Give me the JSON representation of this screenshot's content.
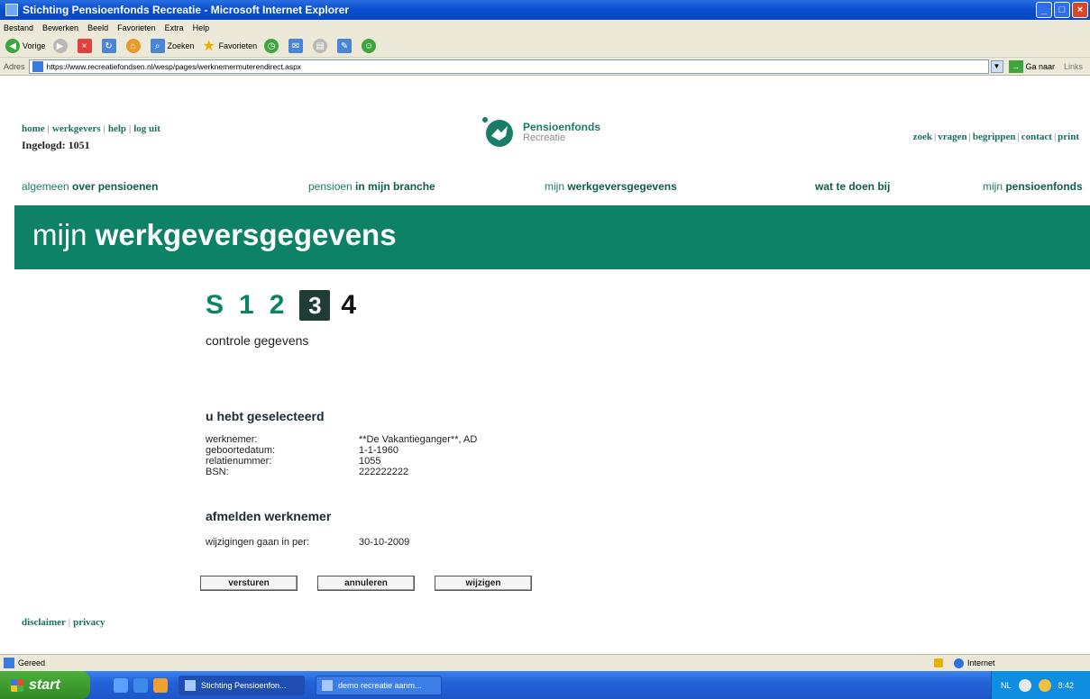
{
  "window": {
    "title": "Stichting Pensioenfonds Recreatie - Microsoft Internet Explorer"
  },
  "menu": [
    "Bestand",
    "Bewerken",
    "Beeld",
    "Favorieten",
    "Extra",
    "Help"
  ],
  "toolbar": {
    "back_label": "Vorige",
    "search_label": "Zoeken",
    "favorites_label": "Favorieten"
  },
  "address": {
    "label": "Adres",
    "url": "https://www.recreatiefondsen.nl/wesp/pages/werknemermuterendirect.aspx",
    "go_label": "Ga naar",
    "links_label": "Links"
  },
  "site": {
    "top_links": [
      "home",
      "werkgevers",
      "help",
      "log uit"
    ],
    "logged_in": "Ingelogd: 1051",
    "logo_title": "Pensioenfonds",
    "logo_subtitle": "Recreatie",
    "util_links": [
      "zoek",
      "vragen",
      "begrippen",
      "contact",
      "print"
    ],
    "nav": [
      {
        "pre": "algemeen ",
        "bold": "over pensioenen"
      },
      {
        "pre": "pensioen ",
        "bold": "in mijn branche"
      },
      {
        "pre": "mijn ",
        "bold": "werkgeversgegevens"
      },
      {
        "pre": "",
        "bold": "wat te doen bij"
      },
      {
        "pre": "mijn ",
        "bold": "pensioenfonds"
      }
    ],
    "banner_pre": "mijn ",
    "banner_bold": "werkgeversgegevens"
  },
  "steps": {
    "items": [
      "S",
      "1",
      "2",
      "3",
      "4"
    ],
    "active": "3",
    "caption": "controle gegevens"
  },
  "selection": {
    "heading": "u hebt geselecteerd",
    "rows": [
      {
        "label": "werknemer:",
        "value": "**De Vakantieganger**, AD"
      },
      {
        "label": "geboortedatum:",
        "value": "1-1-1960"
      },
      {
        "label": "relatienummer:",
        "value": "1055"
      },
      {
        "label": "BSN:",
        "value": "222222222"
      }
    ]
  },
  "deregister": {
    "heading": "afmelden werknemer",
    "rows": [
      {
        "label": "wijzigingen gaan in per:",
        "value": "30-10-2009"
      }
    ]
  },
  "buttons": {
    "send": "versturen",
    "cancel": "annuleren",
    "edit": "wijzigen"
  },
  "footer_links": [
    "disclaimer",
    "privacy"
  ],
  "statusbar": {
    "text": "Gereed",
    "zone": "Internet"
  },
  "taskbar": {
    "start": "start",
    "tasks": [
      "Stichting Pensioenfon...",
      "demo recreatie aanm..."
    ],
    "tray_lang": "NL",
    "clock": "8:42"
  },
  "colors": {
    "brand_green": "#0e8266",
    "link_green": "#1a6f5e",
    "active_step": "#1f3d36"
  }
}
